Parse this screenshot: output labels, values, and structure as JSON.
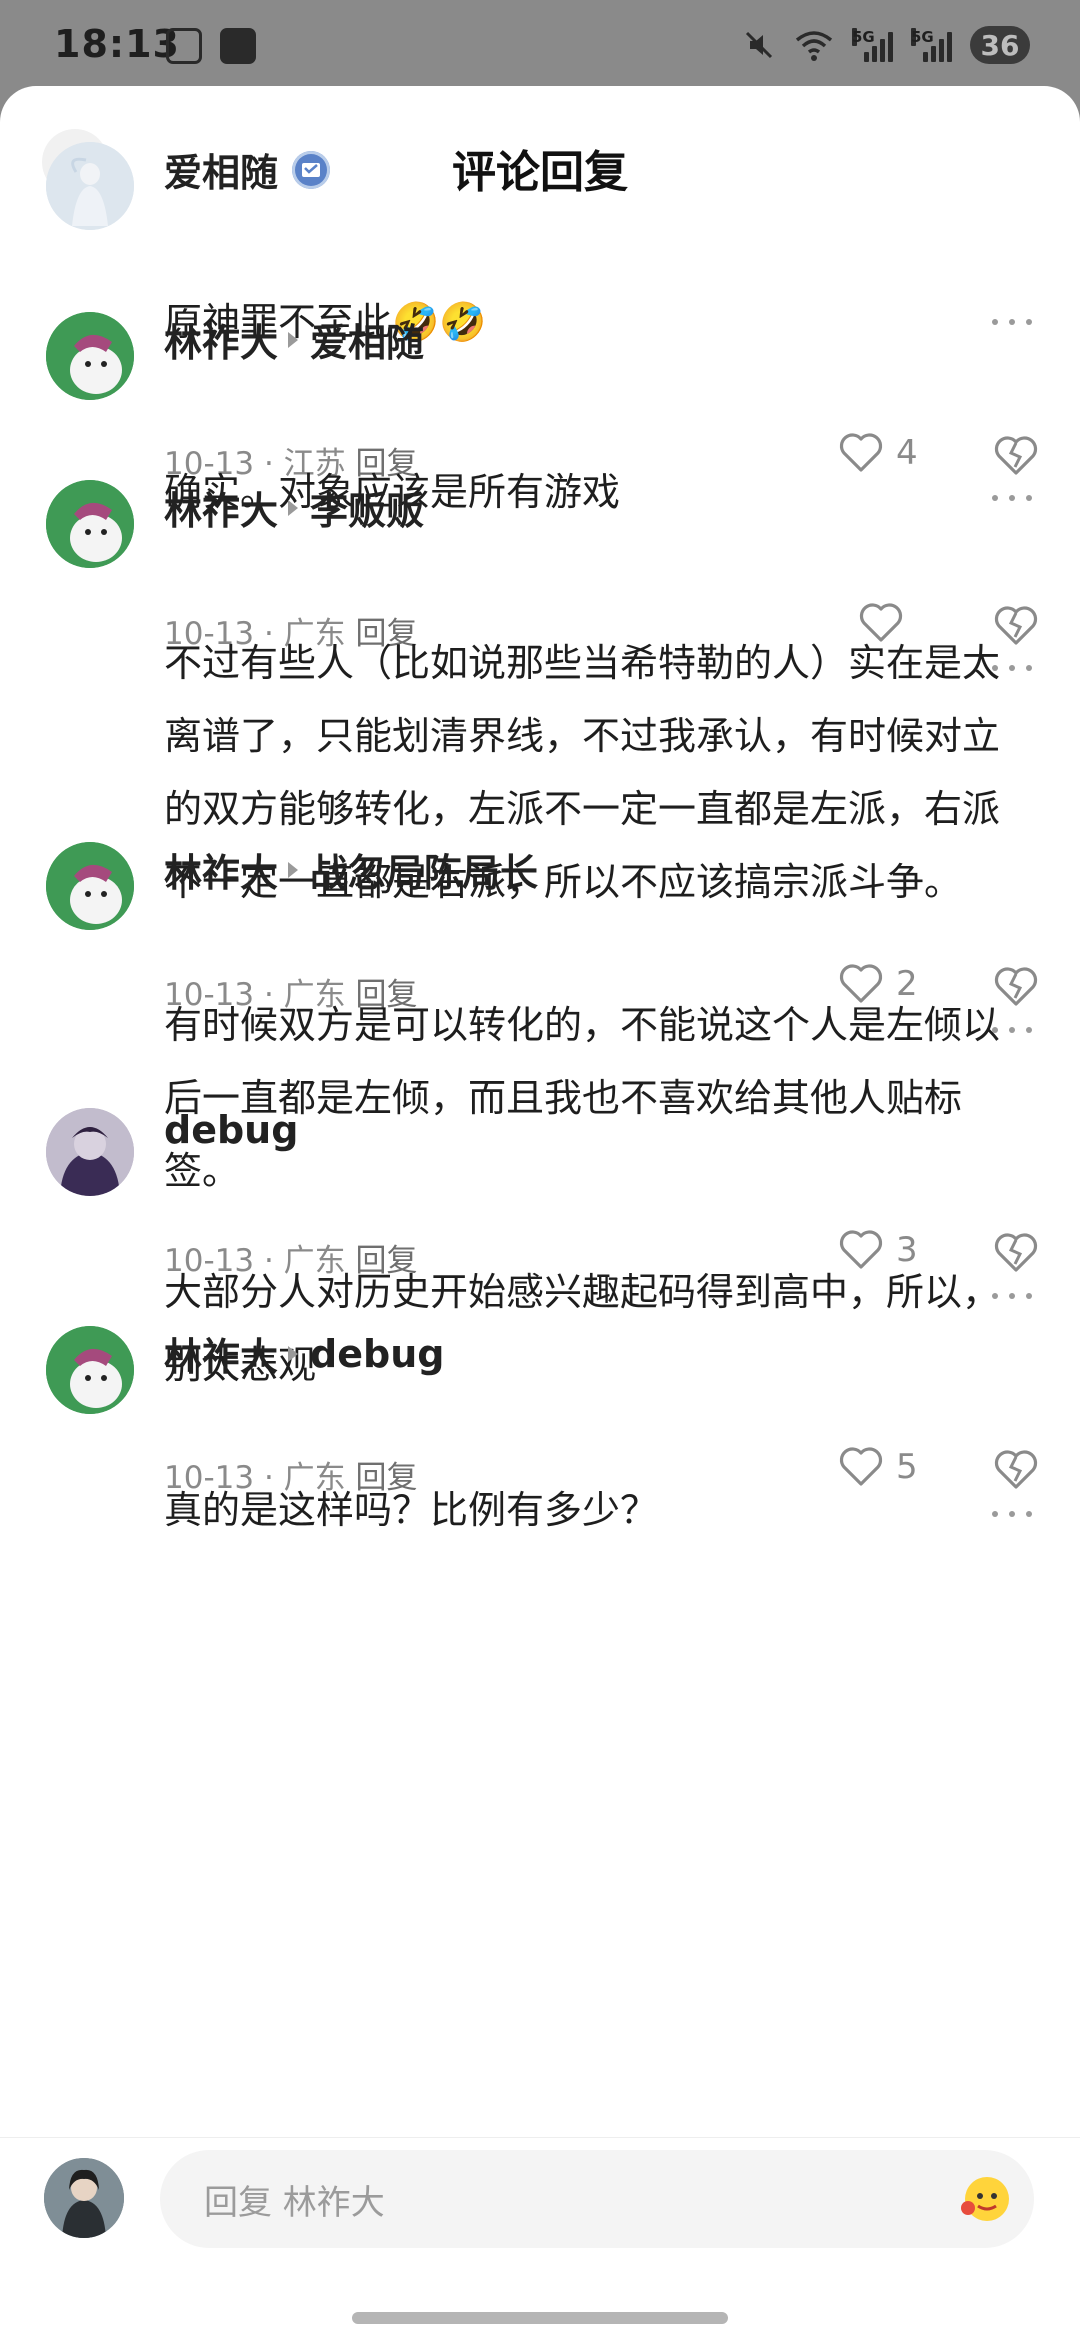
{
  "status_bar": {
    "time": "18:13",
    "network_1": "5G",
    "network_2": "5G",
    "battery": "36",
    "icons": [
      "screenshot-icon",
      "check-box-icon",
      "mute-icon",
      "wifi-icon",
      "signal-icon",
      "signal-icon",
      "battery-icon"
    ]
  },
  "header": {
    "title": "评论回复",
    "back_icon": "chevron-left-icon"
  },
  "comments": [
    {
      "author": "爱相随",
      "verified": true,
      "reply_to": "",
      "text": "原神罪不至此🤣🤣",
      "date": "10-13",
      "location": "江苏",
      "reply_label": "回复",
      "likes": "4"
    },
    {
      "author": "林祚大",
      "reply_to": "爱相随",
      "text": "确实。对象应该是所有游戏",
      "date": "10-13",
      "location": "广东",
      "reply_label": "回复",
      "likes": ""
    },
    {
      "author": "林祚大",
      "reply_to": "李贩贩",
      "text": "不过有些人（比如说那些当希特勒的人）实在是太离谱了，只能划清界线，不过我承认，有时候对立的双方能够转化，左派不一定一直都是左派，右派不一定一直都是右派，所以不应该搞宗派斗争。",
      "date": "10-13",
      "location": "广东",
      "reply_label": "回复",
      "likes": "2"
    },
    {
      "author": "林祚大",
      "reply_to": "战忽局陈局长",
      "text": "有时候双方是可以转化的，不能说这个人是左倾以后一直都是左倾，而且我也不喜欢给其他人贴标签。",
      "date": "10-13",
      "location": "广东",
      "reply_label": "回复",
      "likes": "3"
    },
    {
      "author": "debug",
      "reply_to": "",
      "text": "大部分人对历史开始感兴趣起码得到高中，所以，别太悲观",
      "date": "10-13",
      "location": "广东",
      "reply_label": "回复",
      "likes": "5"
    },
    {
      "author": "林祚大",
      "reply_to": "debug",
      "text": "真的是这样吗？比例有多少？"
    }
  ],
  "composer": {
    "placeholder": "回复 林祚大",
    "emoji_icon": "emoji-icon"
  },
  "colors": {
    "background": "#ffffff",
    "text": "#1e1e1e",
    "muted": "#8a8a8a",
    "verified_badge": "#5a82c8",
    "avatar_dog_green": "#3f9a55"
  }
}
